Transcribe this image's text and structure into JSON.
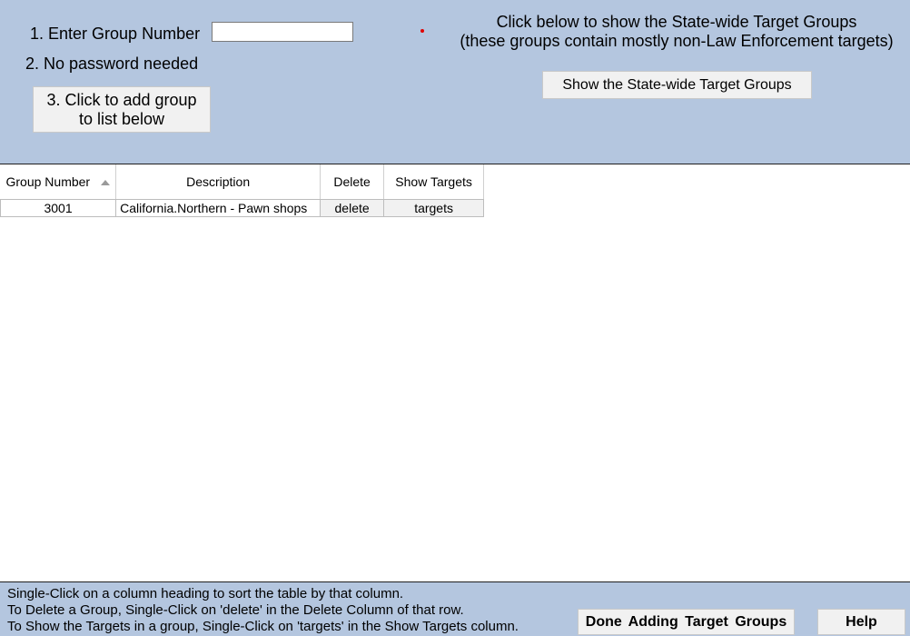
{
  "step1": {
    "label": "1.  Enter Group Number",
    "input_value": ""
  },
  "step2": {
    "label": "2. No password needed"
  },
  "add_button": {
    "line1": "3.  Click to add group",
    "line2": "to list below"
  },
  "statewide": {
    "line1": "Click below to show the State-wide Target Groups",
    "line2": "(these groups contain mostly non-Law Enforcement targets)",
    "button_label": "Show the State-wide Target Groups"
  },
  "table": {
    "headers": [
      "Group Number",
      "Description",
      "Delete",
      "Show Targets"
    ],
    "rows": [
      {
        "group_number": "3001",
        "description": "California.Northern  -  Pawn shops",
        "delete": "delete",
        "show_targets": "targets"
      }
    ]
  },
  "footer": {
    "help_lines": [
      "Single-Click on a column heading to sort the table by that column.",
      "To Delete a Group, Single-Click on 'delete' in the Delete Column of that row.",
      "To Show the Targets in a group, Single-Click on 'targets' in the Show Targets column."
    ],
    "done_label": "Done  Adding  Target  Groups",
    "help_label": "Help"
  },
  "colors": {
    "panel_bg": "#b4c6df",
    "button_bg": "#f1f1f1",
    "marker": "#e00000"
  }
}
